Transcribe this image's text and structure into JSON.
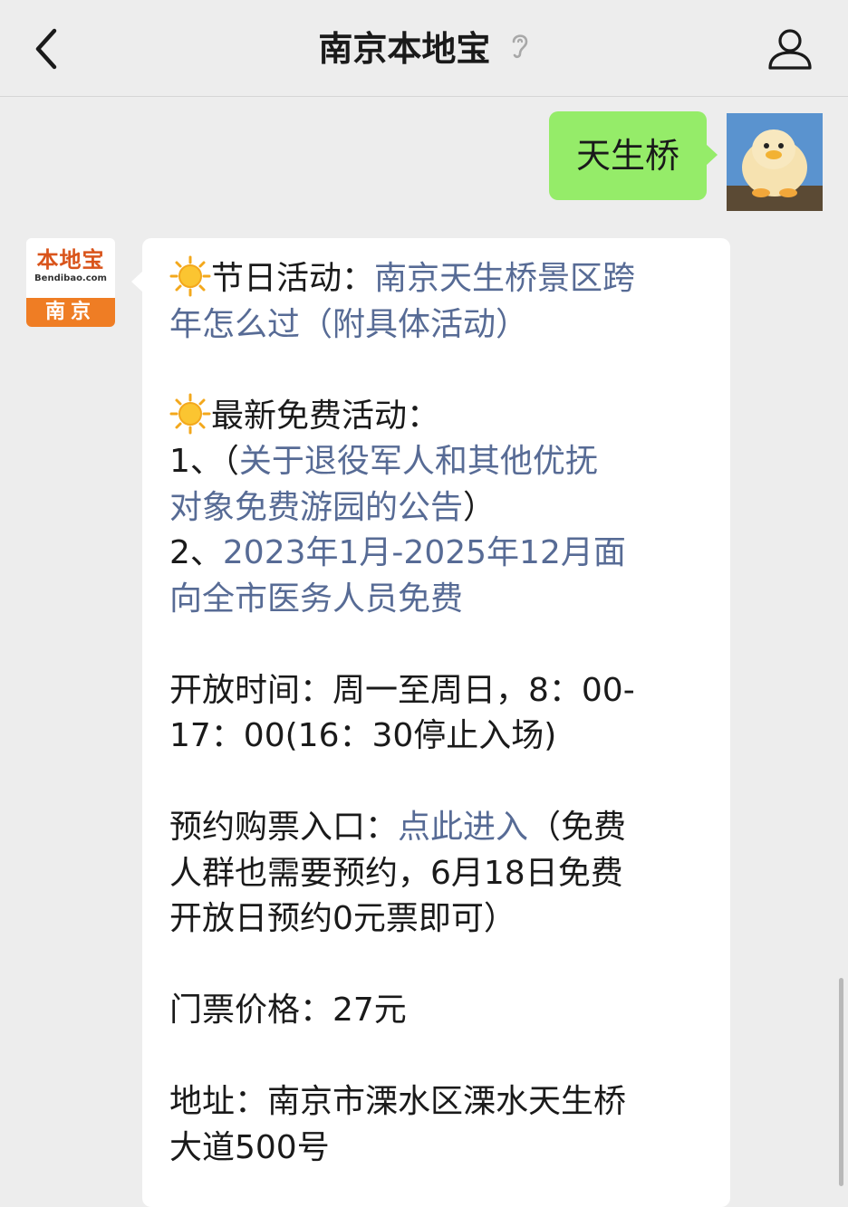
{
  "navbar": {
    "title": "南京本地宝"
  },
  "user_message": {
    "text": "天生桥"
  },
  "bot_avatar": {
    "logo_text": "本地宝",
    "logo_sub": "Bendibao.com",
    "city": "南京"
  },
  "bot_message": {
    "festival_label": "节日活动：",
    "festival_link_1": "南京天生桥景区跨",
    "festival_link_2": "年怎么过（附具体活动）",
    "free_header": "最新免费活动：",
    "item1_prefix": "1、（",
    "item1_link_1": "关于退役军人和其他优抚",
    "item1_link_2": "对象免费游园的公告",
    "item1_suffix": "）",
    "item2_prefix": "2、",
    "item2_link_1": "2023年1月-2025年12月面",
    "item2_link_2": "向全市医务人员免费",
    "hours_1": "开放时间：周一至周日，8：00-",
    "hours_2": "17：00(16：30停止入场)",
    "booking_label": "预约购票入口：",
    "booking_link": "点此进入",
    "booking_note_1": "（免费",
    "booking_note_2": "人群也需要预约，6月18日免费",
    "booking_note_3": "开放日预约0元票即可）",
    "price": "门票价格：27元",
    "address_1": "地址：南京市溧水区溧水天生桥",
    "address_2": "大道500号"
  }
}
